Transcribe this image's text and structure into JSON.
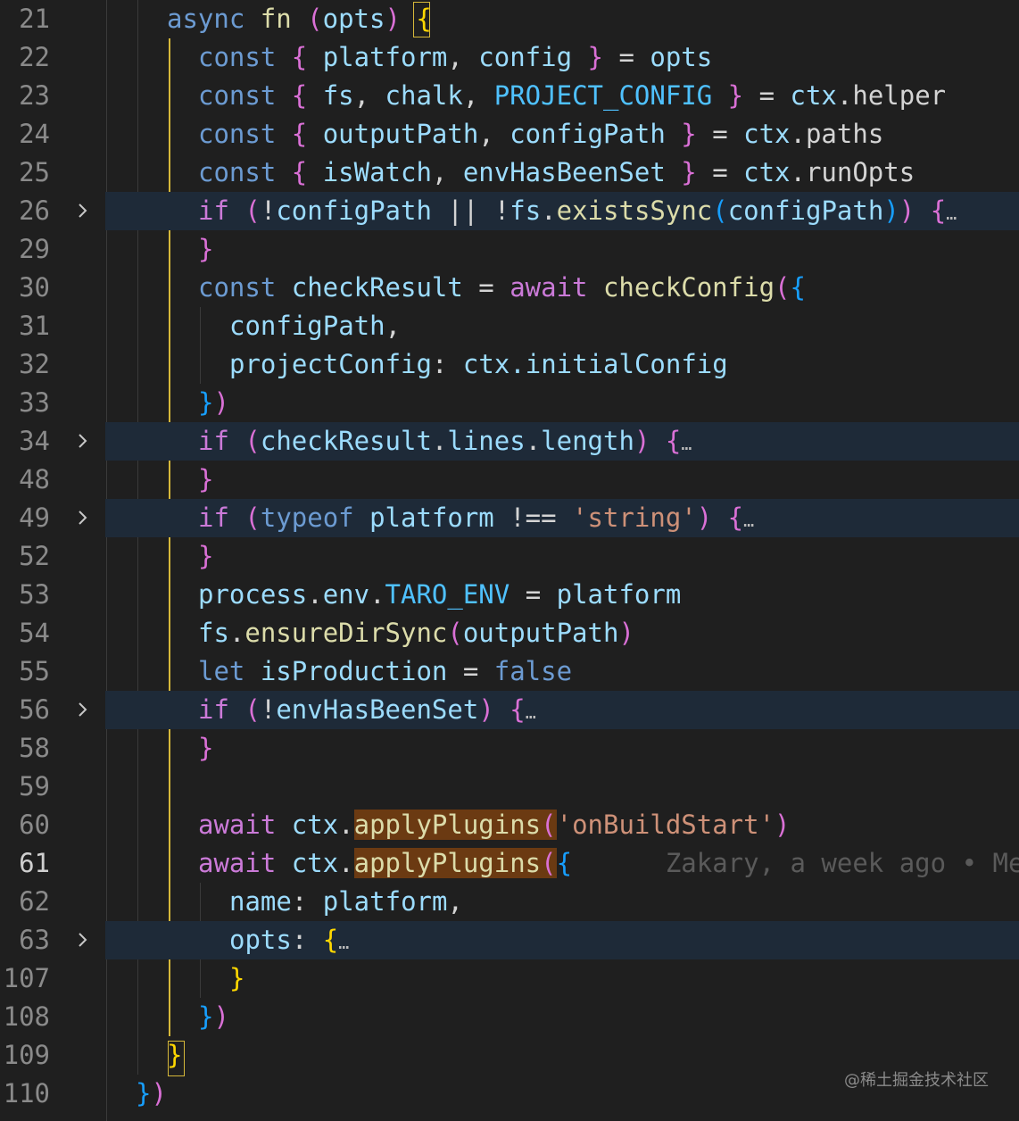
{
  "editor": {
    "lines": [
      {
        "num": "21",
        "code": "async fn (opts) {"
      },
      {
        "num": "22",
        "code": "const { platform, config } = opts"
      },
      {
        "num": "23",
        "code": "const { fs, chalk, PROJECT_CONFIG } = ctx.helper"
      },
      {
        "num": "24",
        "code": "const { outputPath, configPath } = ctx.paths"
      },
      {
        "num": "25",
        "code": "const { isWatch, envHasBeenSet } = ctx.runOpts"
      },
      {
        "num": "26",
        "code": "if (!configPath || !fs.existsSync(configPath)) {…",
        "folded": true
      },
      {
        "num": "29",
        "code": "}"
      },
      {
        "num": "30",
        "code": "const checkResult = await checkConfig({"
      },
      {
        "num": "31",
        "code": "configPath,"
      },
      {
        "num": "32",
        "code": "projectConfig: ctx.initialConfig"
      },
      {
        "num": "33",
        "code": "})"
      },
      {
        "num": "34",
        "code": "if (checkResult.lines.length) {…",
        "folded": true
      },
      {
        "num": "48",
        "code": "}"
      },
      {
        "num": "49",
        "code": "if (typeof platform !== 'string') {…",
        "folded": true
      },
      {
        "num": "52",
        "code": "}"
      },
      {
        "num": "53",
        "code": "process.env.TARO_ENV = platform"
      },
      {
        "num": "54",
        "code": "fs.ensureDirSync(outputPath)"
      },
      {
        "num": "55",
        "code": "let isProduction = false"
      },
      {
        "num": "56",
        "code": "if (!envHasBeenSet) {…",
        "folded": true
      },
      {
        "num": "58",
        "code": "}"
      },
      {
        "num": "59",
        "code": ""
      },
      {
        "num": "60",
        "code": "await ctx.applyPlugins('onBuildStart')"
      },
      {
        "num": "61",
        "code": "await ctx.applyPlugins({",
        "active": true,
        "blame": "Zakary, a week ago • Me"
      },
      {
        "num": "62",
        "code": "name: platform,"
      },
      {
        "num": "63",
        "code": "opts: {…",
        "folded": true
      },
      {
        "num": "107",
        "code": "}"
      },
      {
        "num": "108",
        "code": "})"
      },
      {
        "num": "109",
        "code": "}"
      },
      {
        "num": "110",
        "code": "})"
      }
    ],
    "watermark": "@稀土掘金技术社区"
  },
  "colors": {
    "background": "#1f1f1f",
    "folded_row": "#1e2a38",
    "keyword": "#6c9bd2",
    "control": "#cb7ad8",
    "function": "#dcdcaa",
    "variable": "#9cdcfe",
    "constant": "#4fc1ff",
    "string": "#ce9178",
    "bracket_gold": "#ffd700",
    "bracket_pink": "#da70d6",
    "bracket_blue": "#179fff",
    "match_highlight": "#6b3a12",
    "guide_active": "#d6b83a"
  },
  "icons": {
    "fold": "chevron-right-icon"
  }
}
